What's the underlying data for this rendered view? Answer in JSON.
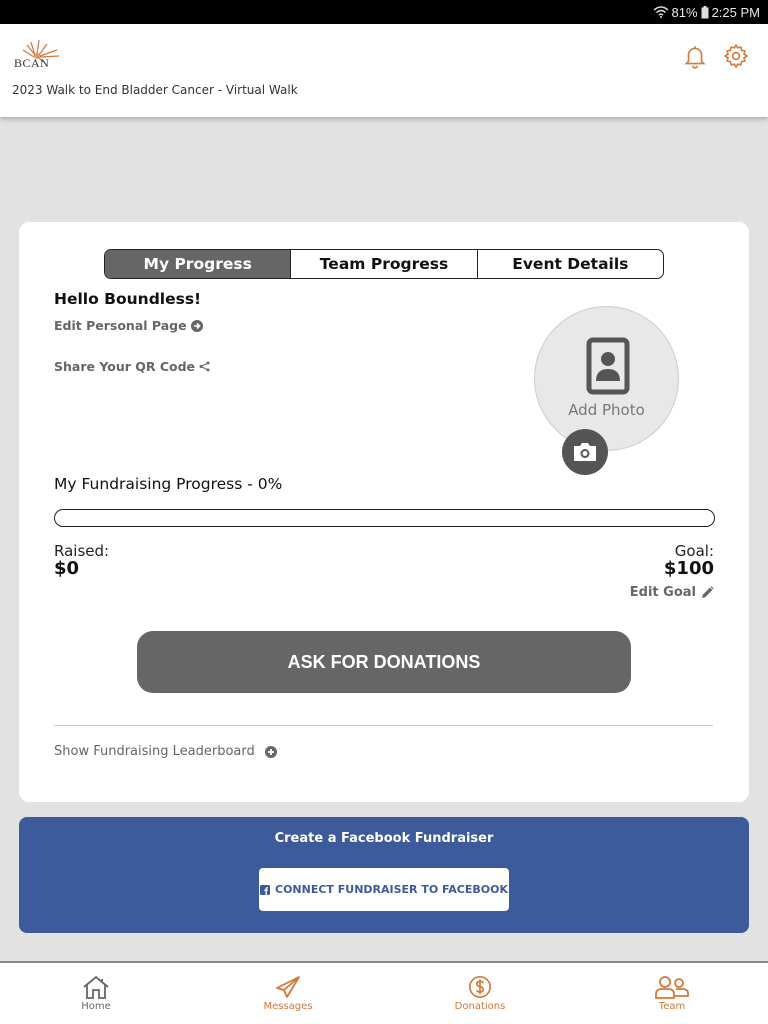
{
  "status_bar": {
    "battery": "81%",
    "time": "2:25 PM"
  },
  "header": {
    "logo_text": "BCAN",
    "event_title": "2023 Walk to End Bladder Cancer - Virtual Walk",
    "accent_color": "#d4773a"
  },
  "tabs": [
    {
      "label": "My Progress",
      "active": true
    },
    {
      "label": "Team Progress",
      "active": false
    },
    {
      "label": "Event Details",
      "active": false
    }
  ],
  "profile": {
    "greeting": "Hello Boundless!",
    "edit_page_label": "Edit Personal Page",
    "share_qr_label": "Share Your QR Code",
    "add_photo_label": "Add Photo"
  },
  "fundraising": {
    "title": "My Fundraising Progress - 0%",
    "progress_percent": 0,
    "raised_label": "Raised:",
    "raised_value": "$0",
    "goal_label": "Goal:",
    "goal_value": "$100",
    "edit_goal_label": "Edit Goal",
    "ask_button_label": "ASK FOR DONATIONS",
    "leaderboard_label": "Show Fundraising Leaderboard"
  },
  "facebook": {
    "title": "Create a Facebook Fundraiser",
    "button_label": "CONNECT FUNDRAISER TO FACEBOOK",
    "bg_color": "#3d5a9a"
  },
  "bottom_nav": [
    {
      "label": "Home",
      "icon": "home-icon"
    },
    {
      "label": "Messages",
      "icon": "paper-plane-icon"
    },
    {
      "label": "Donations",
      "icon": "dollar-circle-icon"
    },
    {
      "label": "Team",
      "icon": "team-icon"
    }
  ]
}
